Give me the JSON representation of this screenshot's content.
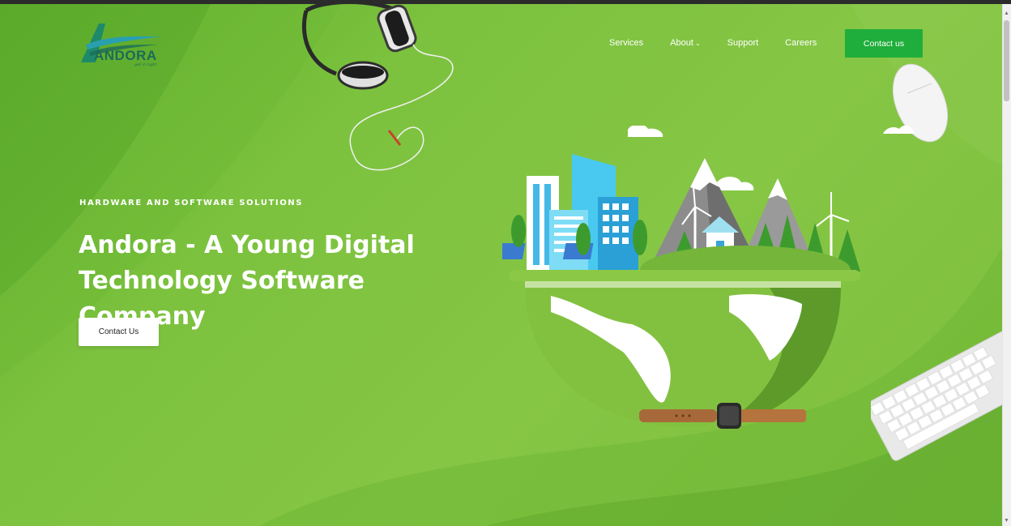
{
  "brand": {
    "name": "ANDORA",
    "tagline": "get it right"
  },
  "nav": {
    "items": [
      {
        "label": "Services"
      },
      {
        "label": "About"
      },
      {
        "label": "Support"
      },
      {
        "label": "Careers"
      }
    ],
    "about_chevron": "⌄",
    "contact_label": "Contact us"
  },
  "hero": {
    "eyebrow": "HARDWARE AND SOFTWARE SOLUTIONS",
    "title": "Andora - A Young Digital Technology Software Company",
    "button_label": "Contact Us"
  },
  "colors": {
    "background": "#7fc040",
    "primary_button": "#1fae3b",
    "text": "#ffffff"
  },
  "icons": [
    "headphones-icon",
    "mouse-icon",
    "keyboard-icon",
    "smartwatch-icon",
    "earth-city-illustration"
  ]
}
